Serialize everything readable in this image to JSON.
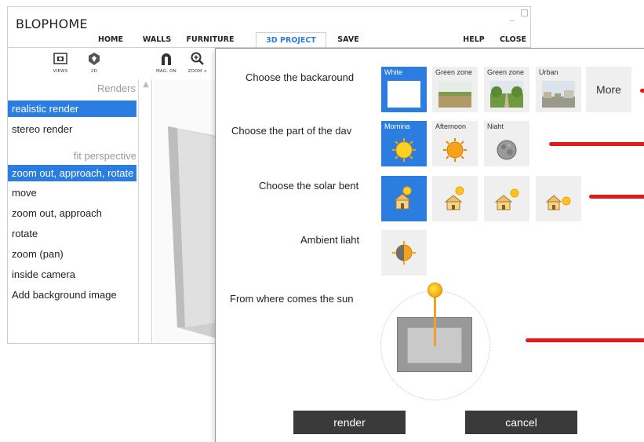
{
  "app": {
    "title": "BLOPHOME",
    "nav": [
      "HOME",
      "WALLS",
      "FURNITURE",
      "3D PROJECT",
      "SAVE",
      "HELP",
      "CLOSE"
    ],
    "active_nav": "3D PROJECT",
    "tools": [
      {
        "label": "VIEWS",
        "icon": "camera-icon"
      },
      {
        "label": "2D",
        "icon": "2d-icon"
      },
      {
        "label": "MAG. ON",
        "icon": "magnet-icon"
      },
      {
        "label": "ZOOM +",
        "icon": "zoom-in-icon"
      }
    ]
  },
  "sidebar": {
    "section_title": "Renders",
    "items": [
      "realistic render",
      "stereo render"
    ],
    "selected_render": "realistic render",
    "subsection_title": "fit perspective",
    "perspective_items": [
      "zoom out, approach, rotate",
      "move",
      "zoom out, approach",
      "rotate",
      "zoom (pan)",
      "inside camera",
      "Add background image"
    ],
    "selected_perspective": "zoom out, approach, rotate"
  },
  "dialog": {
    "background": {
      "label": "Choose the backaround",
      "options": [
        "White",
        "Green zone",
        "Green zone",
        "Urban"
      ],
      "selected": "White",
      "more_label": "More"
    },
    "day_part": {
      "label": "Choose the part of the dav",
      "options": [
        "Mornina",
        "Afternoon",
        "Niaht"
      ],
      "selected": "Mornina"
    },
    "solar_bent": {
      "label": "Choose the solar bent",
      "option_count": 4,
      "selected_index": 0
    },
    "ambient": {
      "label": "Ambient liaht"
    },
    "sun_position": {
      "label": "From where comes the sun"
    },
    "render_button": "render",
    "cancel_button": "cancel"
  },
  "colors": {
    "accent": "#2b7de0",
    "annotation": "#e31a1a",
    "button_dark": "#3a3a3a",
    "sun": "#f5a400"
  }
}
